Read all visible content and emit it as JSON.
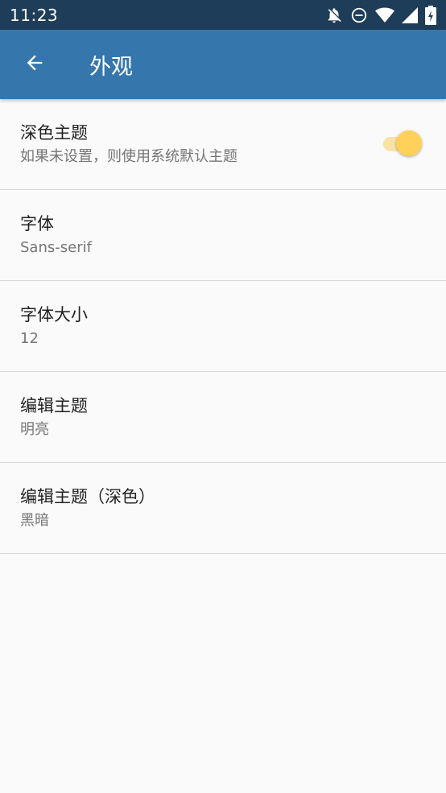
{
  "status_bar": {
    "time": "11:23",
    "icons": [
      "notifications-off-icon",
      "do-not-disturb-icon",
      "wifi-icon",
      "signal-icon",
      "battery-charging-icon"
    ]
  },
  "app_bar": {
    "back_icon": "arrow-back-icon",
    "title": "外观"
  },
  "settings": [
    {
      "title": "深色主题",
      "summary": "如果未设置，则使用系统默认主题",
      "switch_on": true
    },
    {
      "title": "字体",
      "summary": "Sans-serif"
    },
    {
      "title": "字体大小",
      "summary": "12"
    },
    {
      "title": "编辑主题",
      "summary": "明亮"
    },
    {
      "title": "编辑主题（深色）",
      "summary": "黑暗"
    }
  ],
  "colors": {
    "status_bar": "#1e3d59",
    "app_bar": "#3577ad",
    "switch_thumb": "#ffd15a",
    "switch_track": "#f7e3a8"
  }
}
